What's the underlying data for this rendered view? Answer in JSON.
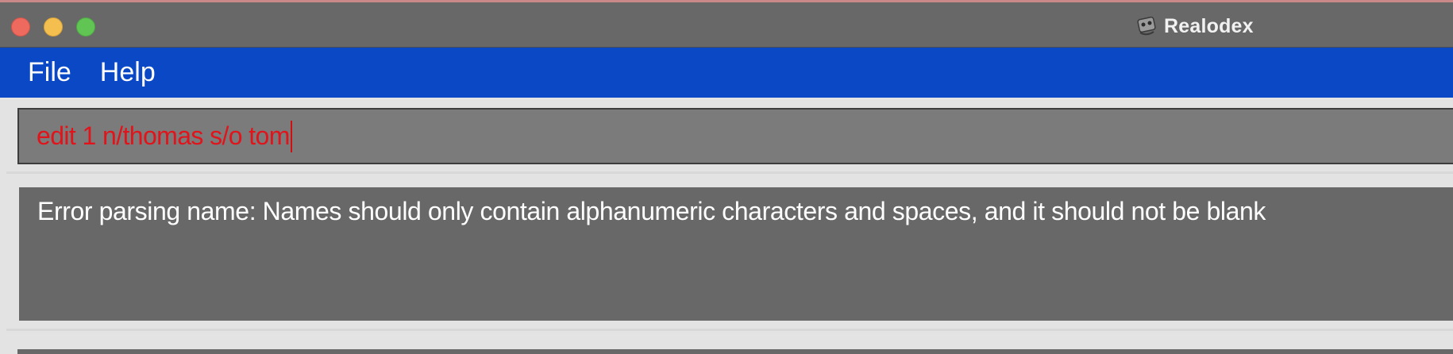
{
  "window": {
    "title": "Realodex",
    "icon": "realodex-app-icon"
  },
  "menu": {
    "items": [
      {
        "label": "File"
      },
      {
        "label": "Help"
      }
    ]
  },
  "command": {
    "value": "edit 1 n/thomas s/o tom"
  },
  "result": {
    "message": "Error parsing name: Names should only contain alphanumeric characters and spaces, and it should not be blank"
  },
  "colors": {
    "menubar": "#0a48c6",
    "command_error_text": "#e0141a",
    "panel_bg": "#686868"
  }
}
